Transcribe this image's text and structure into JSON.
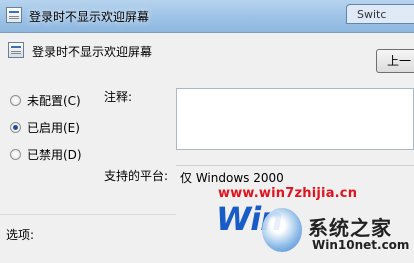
{
  "window": {
    "title": "登录时不显示欢迎屏幕",
    "tab_label": "Switc"
  },
  "header": {
    "policy_name": "登录时不显示欢迎屏幕",
    "prev_button": "上一"
  },
  "radios": [
    {
      "label": "未配置(C)",
      "checked": false
    },
    {
      "label": "已启用(E)",
      "checked": true
    },
    {
      "label": "已禁用(D)",
      "checked": false
    }
  ],
  "fields": {
    "comment_label": "注释:",
    "platform_label": "支持的平台:",
    "platform_value": "仅 Windows 2000"
  },
  "footer": {
    "options_label": "选项:"
  },
  "watermark": {
    "url": "www.win7zhijia.cn",
    "big_text": "Win",
    "brand": "系统之家",
    "site": "Win10net.com"
  }
}
